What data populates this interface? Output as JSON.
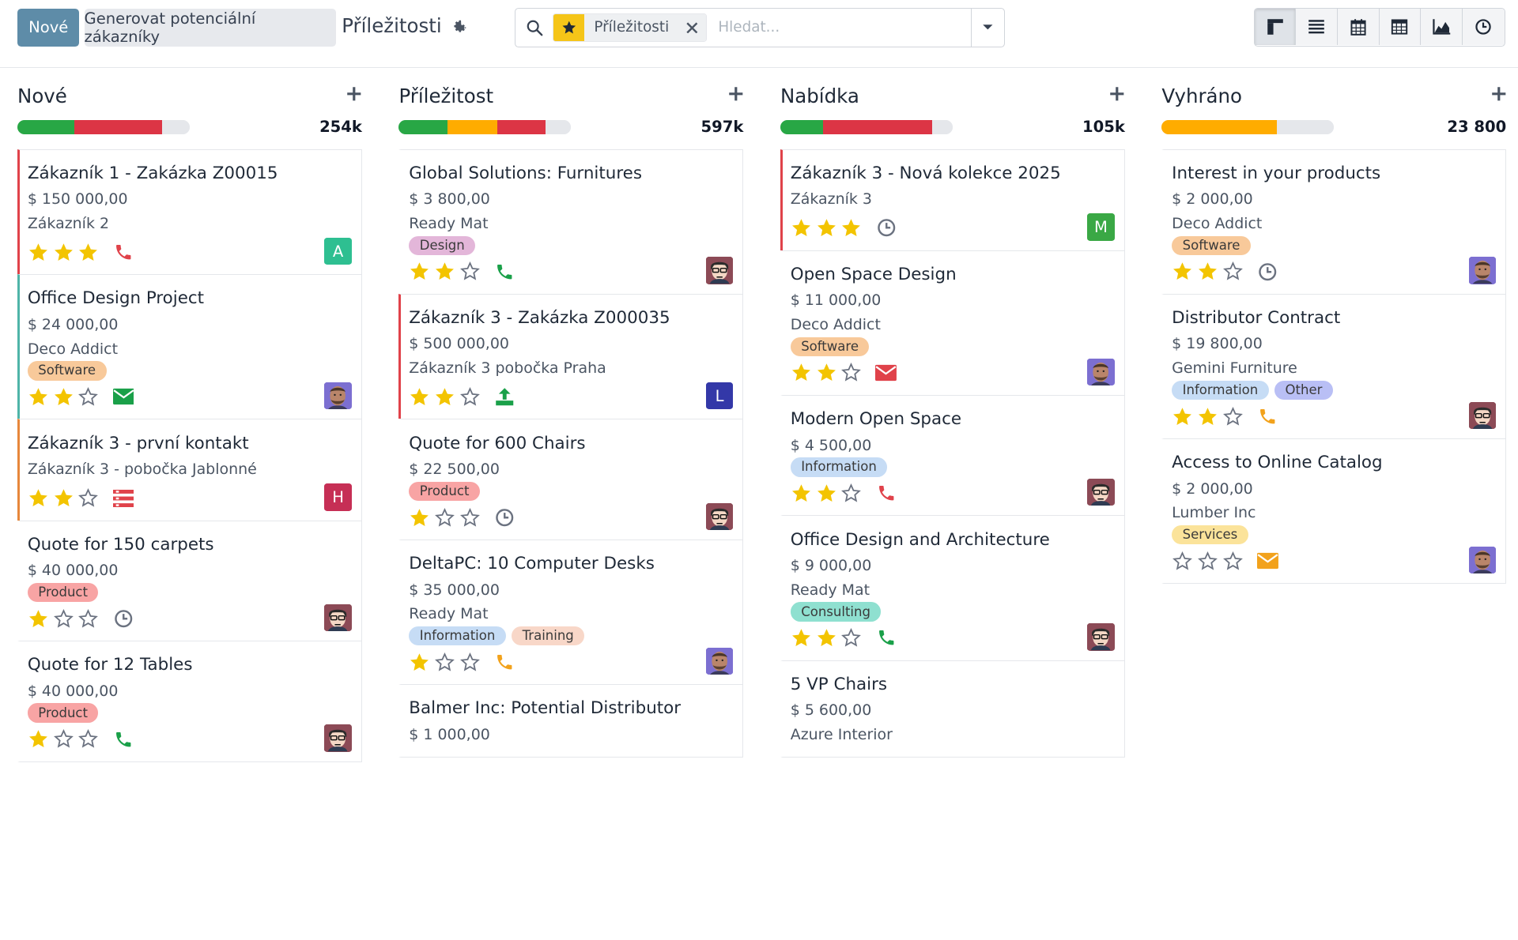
{
  "control_panel": {
    "new_button": "Nové",
    "generate_button": "Generovat potenciální zákazníky",
    "breadcrumb": "Příležitosti",
    "search": {
      "facet": "Příležitosti",
      "placeholder": "Hledat..."
    },
    "views": [
      "kanban-icon",
      "list-icon",
      "calendar-icon",
      "pivot-icon",
      "graph-icon",
      "activity-icon"
    ]
  },
  "columns": [
    {
      "title": "Nové",
      "total": "254k",
      "progress": [
        {
          "color": "#28a745",
          "fraction": 0.33
        },
        {
          "color": "#dc3545",
          "fraction": 0.51
        },
        {
          "color": "#e5e7eb",
          "fraction": 0.16
        }
      ],
      "cards": [
        {
          "title": "Zákazník 1 - Zakázka Z00015",
          "amount": "$ 150 000,00",
          "customer": "Zákazník 2",
          "tags": [],
          "stars": 3,
          "activity": "phone-icon",
          "activity_color": "#e0424a",
          "avatar": "A",
          "avatar_color": "#2ebf91",
          "accent": "#e0424a"
        },
        {
          "title": "Office Design Project",
          "amount": "$ 24 000,00",
          "customer": "Deco Addict",
          "tags": [
            {
              "label": "Software",
              "color": "#f8c99a"
            }
          ],
          "stars": 2,
          "activity": "email-icon",
          "activity_color": "#1aa049",
          "avatar": "photo-b",
          "avatar_color": "#7c6fd1",
          "accent": "#4fb4a8"
        },
        {
          "title": "Zákazník 3 - první kontakt",
          "amount": "Zákazník 3 - pobočka Jablonné",
          "customer": "",
          "tags": [],
          "stars": 2,
          "activity": "tasks-icon",
          "activity_color": "#e0424a",
          "avatar": "H",
          "avatar_color": "#c62f55",
          "accent": "#e7873b"
        },
        {
          "title": "Quote for 150 carpets",
          "amount": "$ 40 000,00",
          "customer": "",
          "tags": [
            {
              "label": "Product",
              "color": "#f8a4a4"
            }
          ],
          "stars": 1,
          "activity": "clock-icon",
          "activity_color": "#6b7280",
          "avatar": "photo-a",
          "avatar_color": "#8c4a56",
          "accent": "transparent"
        },
        {
          "title": "Quote for 12 Tables",
          "amount": "$ 40 000,00",
          "customer": "",
          "tags": [
            {
              "label": "Product",
              "color": "#f8a4a4"
            }
          ],
          "stars": 1,
          "activity": "phone-icon",
          "activity_color": "#1aa049",
          "avatar": "photo-a",
          "avatar_color": "#8c4a56",
          "accent": "transparent"
        }
      ]
    },
    {
      "title": "Příležitost",
      "total": "597k",
      "progress": [
        {
          "color": "#28a745",
          "fraction": 0.28
        },
        {
          "color": "#ffac00",
          "fraction": 0.29
        },
        {
          "color": "#dc3545",
          "fraction": 0.28
        },
        {
          "color": "#e5e7eb",
          "fraction": 0.15
        }
      ],
      "cards": [
        {
          "title": "Global Solutions: Furnitures",
          "amount": "$ 3 800,00",
          "customer": "Ready Mat",
          "tags": [
            {
              "label": "Design",
              "color": "#e3b6d9"
            }
          ],
          "stars": 2,
          "activity": "phone-icon",
          "activity_color": "#1aa049",
          "avatar": "photo-a",
          "avatar_color": "#8c4a56",
          "accent": "transparent"
        },
        {
          "title": "Zákazník 3 - Zakázka Z000035",
          "amount": "$ 500 000,00",
          "customer": "Zákazník 3 pobočka Praha",
          "tags": [],
          "stars": 2,
          "activity": "upload-icon",
          "activity_color": "#1aa049",
          "avatar": "L",
          "avatar_color": "#3338a8",
          "accent": "#e0424a"
        },
        {
          "title": "Quote for 600 Chairs",
          "amount": "$ 22 500,00",
          "customer": "",
          "tags": [
            {
              "label": "Product",
              "color": "#f8a4a4"
            }
          ],
          "stars": 1,
          "activity": "clock-icon",
          "activity_color": "#6b7280",
          "avatar": "photo-a",
          "avatar_color": "#8c4a56",
          "accent": "transparent"
        },
        {
          "title": "DeltaPC: 10 Computer Desks",
          "amount": "$ 35 000,00",
          "customer": "Ready Mat",
          "tags": [
            {
              "label": "Information",
              "color": "#c6dcf5"
            },
            {
              "label": "Training",
              "color": "#f8d7c8"
            }
          ],
          "stars": 1,
          "activity": "phone-icon",
          "activity_color": "#f2a21c",
          "avatar": "photo-b",
          "avatar_color": "#7c6fd1",
          "accent": "transparent"
        },
        {
          "title": "Balmer Inc: Potential Distributor",
          "amount": "$ 1 000,00",
          "customer": "",
          "tags": [],
          "stars": 0,
          "activity": "",
          "activity_color": "",
          "avatar": "",
          "avatar_color": "",
          "accent": "transparent"
        }
      ]
    },
    {
      "title": "Nabídka",
      "total": "105k",
      "progress": [
        {
          "color": "#28a745",
          "fraction": 0.25
        },
        {
          "color": "#dc3545",
          "fraction": 0.63
        },
        {
          "color": "#e5e7eb",
          "fraction": 0.12
        }
      ],
      "cards": [
        {
          "title": "Zákazník 3 - Nová kolekce 2025",
          "amount": "Zákazník 3",
          "customer": "",
          "tags": [],
          "stars": 3,
          "activity": "clock-icon",
          "activity_color": "#6b7280",
          "avatar": "M",
          "avatar_color": "#3aa845",
          "accent": "#e0424a"
        },
        {
          "title": "Open Space Design",
          "amount": "$ 11 000,00",
          "customer": "Deco Addict",
          "tags": [
            {
              "label": "Software",
              "color": "#f8c99a"
            }
          ],
          "stars": 2,
          "activity": "email-icon",
          "activity_color": "#e0424a",
          "avatar": "photo-b",
          "avatar_color": "#7c6fd1",
          "accent": "transparent"
        },
        {
          "title": "Modern Open Space",
          "amount": "$ 4 500,00",
          "customer": "",
          "tags": [
            {
              "label": "Information",
              "color": "#c6dcf5"
            }
          ],
          "stars": 2,
          "activity": "phone-icon",
          "activity_color": "#e0424a",
          "avatar": "photo-a",
          "avatar_color": "#8c4a56",
          "accent": "transparent"
        },
        {
          "title": "Office Design and Architecture",
          "amount": "$ 9 000,00",
          "customer": "Ready Mat",
          "tags": [
            {
              "label": "Consulting",
              "color": "#8fe0d0"
            }
          ],
          "stars": 2,
          "activity": "phone-icon",
          "activity_color": "#1aa049",
          "avatar": "photo-a",
          "avatar_color": "#8c4a56",
          "accent": "transparent"
        },
        {
          "title": "5 VP Chairs",
          "amount": "$ 5 600,00",
          "customer": "Azure Interior",
          "tags": [],
          "stars": 0,
          "activity": "",
          "activity_color": "",
          "avatar": "",
          "avatar_color": "",
          "accent": "transparent"
        }
      ]
    },
    {
      "title": "Vyhráno",
      "total": "23 800",
      "progress": [
        {
          "color": "#ffac00",
          "fraction": 0.67
        },
        {
          "color": "#e5e7eb",
          "fraction": 0.33
        }
      ],
      "cards": [
        {
          "title": "Interest in your products",
          "amount": "$ 2 000,00",
          "customer": "Deco Addict",
          "tags": [
            {
              "label": "Software",
              "color": "#f8c99a"
            }
          ],
          "stars": 2,
          "activity": "clock-icon",
          "activity_color": "#6b7280",
          "avatar": "photo-b",
          "avatar_color": "#7c6fd1",
          "accent": "transparent"
        },
        {
          "title": "Distributor Contract",
          "amount": "$ 19 800,00",
          "customer": "Gemini Furniture",
          "tags": [
            {
              "label": "Information",
              "color": "#c6dcf5"
            },
            {
              "label": "Other",
              "color": "#b9bff5"
            }
          ],
          "stars": 2,
          "activity": "phone-icon",
          "activity_color": "#f2a21c",
          "avatar": "photo-a",
          "avatar_color": "#8c4a56",
          "accent": "transparent"
        },
        {
          "title": "Access to Online Catalog",
          "amount": "$ 2 000,00",
          "customer": "Lumber Inc",
          "tags": [
            {
              "label": "Services",
              "color": "#fbe39a"
            }
          ],
          "stars": 0,
          "activity": "email-icon",
          "activity_color": "#f2a21c",
          "avatar": "photo-b",
          "avatar_color": "#7c6fd1",
          "accent": "transparent"
        }
      ]
    }
  ]
}
